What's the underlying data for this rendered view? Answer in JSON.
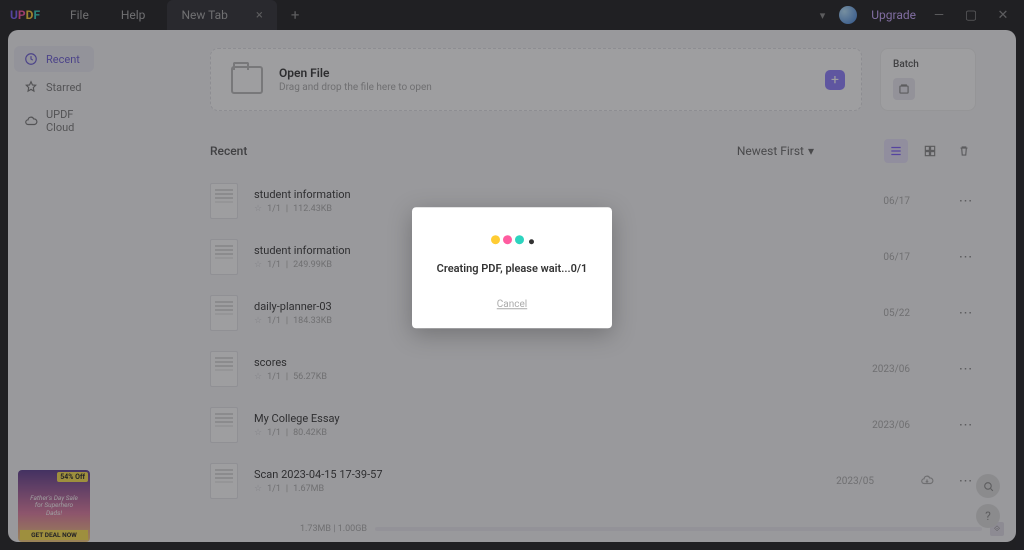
{
  "titlebar": {
    "logo": "UPDF",
    "menu": {
      "file": "File",
      "help": "Help"
    },
    "tab_label": "New Tab",
    "upgrade": "Upgrade"
  },
  "sidebar": {
    "items": [
      {
        "label": "Recent",
        "icon": "clock-icon",
        "active": true
      },
      {
        "label": "Starred",
        "icon": "star-icon",
        "active": false
      },
      {
        "label": "UPDF Cloud",
        "icon": "cloud-icon",
        "active": false
      }
    ]
  },
  "openfile": {
    "title": "Open File",
    "subtitle": "Drag and drop the file here to open"
  },
  "batch": {
    "title": "Batch"
  },
  "listheader": {
    "title": "Recent",
    "sort_label": "Newest First"
  },
  "files": [
    {
      "name": "student information",
      "pages": "1/1",
      "size": "112.43KB",
      "date": "06/17",
      "cloud": false
    },
    {
      "name": "student information",
      "pages": "1/1",
      "size": "249.99KB",
      "date": "06/17",
      "cloud": false
    },
    {
      "name": "daily-planner-03",
      "pages": "1/1",
      "size": "184.33KB",
      "date": "05/22",
      "cloud": false
    },
    {
      "name": "scores",
      "pages": "1/1",
      "size": "56.27KB",
      "date": "2023/06",
      "cloud": false
    },
    {
      "name": "My College Essay",
      "pages": "1/1",
      "size": "80.42KB",
      "date": "2023/06",
      "cloud": false
    },
    {
      "name": "Scan 2023-04-15 17-39-57",
      "pages": "1/1",
      "size": "1.67MB",
      "date": "2023/05",
      "cloud": true
    }
  ],
  "status": {
    "used": "1.73MB",
    "total": "1.00GB"
  },
  "promo": {
    "off": "54% Off",
    "line1": "Father's Day Sale",
    "line2": "for Superhero",
    "line3": "Dads!",
    "cta": "GET DEAL NOW"
  },
  "modal": {
    "message": "Creating PDF, please wait...0/1",
    "cancel": "Cancel"
  }
}
